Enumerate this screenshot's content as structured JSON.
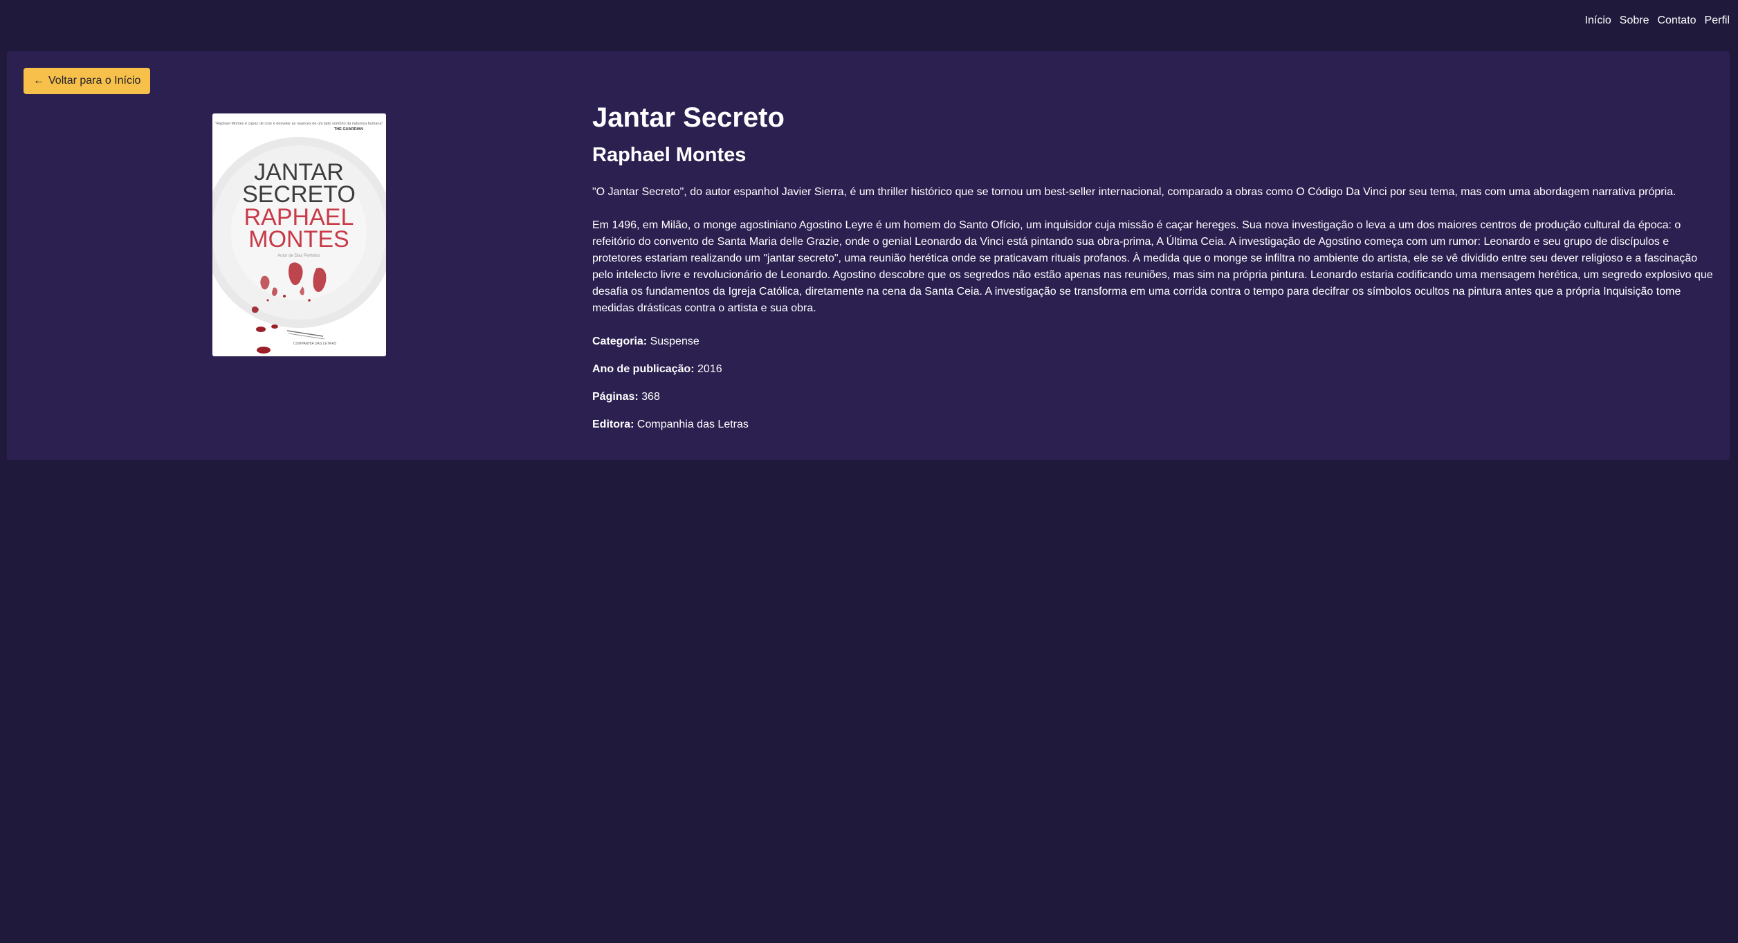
{
  "nav": {
    "items": [
      "Início",
      "Sobre",
      "Contato",
      "Perfil"
    ]
  },
  "back_button": {
    "arrow": "←",
    "label": "Voltar para o Início"
  },
  "book": {
    "title": "Jantar Secreto",
    "author": "Raphael Montes",
    "description": [
      "\"O Jantar Secreto\", do autor espanhol Javier Sierra, é um thriller histórico que se tornou um best-seller internacional, comparado a obras como O Código Da Vinci por seu tema, mas com uma abordagem narrativa própria.",
      "Em 1496, em Milão, o monge agostiniano Agostino Leyre é um homem do Santo Ofício, um inquisidor cuja missão é caçar hereges. Sua nova investigação o leva a um dos maiores centros de produção cultural da época: o refeitório do convento de Santa Maria delle Grazie, onde o genial Leonardo da Vinci está pintando sua obra-prima, A Última Ceia. A investigação de Agostino começa com um rumor: Leonardo e seu grupo de discípulos e protetores estariam realizando um \"jantar secreto\", uma reunião herética onde se praticavam rituais profanos. À medida que o monge se infiltra no ambiente do artista, ele se vê dividido entre seu dever religioso e a fascinação pelo intelecto livre e revolucionário de Leonardo. Agostino descobre que os segredos não estão apenas nas reuniões, mas sim na própria pintura. Leonardo estaria codificando uma mensagem herética, um segredo explosivo que desafia os fundamentos da Igreja Católica, diretamente na cena da Santa Ceia. A investigação se transforma em uma corrida contra o tempo para decifrar os símbolos ocultos na pintura antes que a própria Inquisição tome medidas drásticas contra o artista e sua obra."
    ],
    "meta": {
      "category_label": "Categoria:",
      "category": "Suspense",
      "year_label": "Ano de publicação:",
      "year": "2016",
      "pages_label": "Páginas:",
      "pages": "368",
      "publisher_label": "Editora:",
      "publisher": "Companhia das Letras"
    },
    "cover": {
      "blurb": "\"Raphael Montes é capaz de criar e desvelar as nuances de um lado sombrio da natureza humana\"",
      "blurb_source": "THE GUARDIAN",
      "title_line1": "JANTAR",
      "title_line2": "SECRETO",
      "author_line1": "RAPHAEL",
      "author_line2": "MONTES",
      "subtitle": "Autor de Dias Perfeitos",
      "publisher_mark": "COMPANHIA DAS LETRAS"
    }
  },
  "colors": {
    "background": "#1f1a3b",
    "card": "#2b2050",
    "accent": "#f7c04a",
    "cover_red": "#c83a48"
  }
}
